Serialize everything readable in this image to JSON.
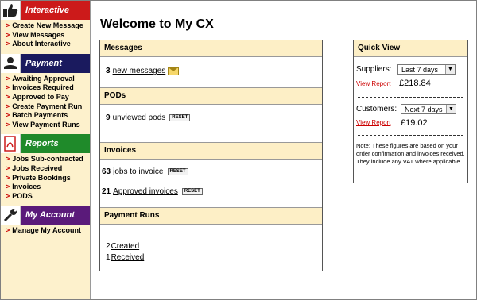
{
  "sidebar": {
    "sections": [
      {
        "title": "Interactive",
        "color": "#cc1a1a",
        "icon": "thumbs-up-icon",
        "items": [
          "Create New Message",
          "View Messages",
          "About Interactive"
        ]
      },
      {
        "title": "Payment",
        "color": "#1a1a5e",
        "icon": "payment-icon",
        "items": [
          "Awaiting Approval",
          "Invoices Required",
          "Approved to Pay",
          "Create Payment Run",
          "Batch Payments",
          "View Payment Runs"
        ]
      },
      {
        "title": "Reports",
        "color": "#1f8a2a",
        "icon": "pdf-icon",
        "items": [
          "Jobs Sub-contracted",
          "Jobs Received",
          "Private Bookings",
          "Invoices",
          "PODS"
        ]
      },
      {
        "title": "My Account",
        "color": "#5a1a7a",
        "icon": "wrench-icon",
        "items": [
          "Manage My Account"
        ]
      }
    ]
  },
  "main": {
    "heading": "Welcome to My CX",
    "panels": {
      "messages": {
        "title": "Messages",
        "count": "3",
        "link": "new messages"
      },
      "pods": {
        "title": "PODs",
        "count": "9",
        "link": "unviewed pods",
        "reset": "RESET"
      },
      "invoices": {
        "title": "Invoices",
        "rows": [
          {
            "count": "63",
            "link": "jobs to invoice",
            "reset": "RESET"
          },
          {
            "count": "21",
            "link": "Approved invoices",
            "reset": "RESET"
          }
        ]
      },
      "payment_runs": {
        "title": "Payment Runs",
        "rows": [
          {
            "count": "2",
            "link": "Created"
          },
          {
            "count": "1",
            "link": "Received"
          }
        ]
      }
    }
  },
  "quick_view": {
    "title": "Quick View",
    "suppliers": {
      "label": "Suppliers:",
      "selected": "Last 7 days",
      "report": "View Report",
      "amount": "£218.84"
    },
    "customers": {
      "label": "Customers:",
      "selected": "Next 7 days",
      "report": "View Report",
      "amount": "£19.02"
    },
    "note": "Note: These figures are based on your order confirmation and invoices received. They include any VAT where applicable."
  }
}
